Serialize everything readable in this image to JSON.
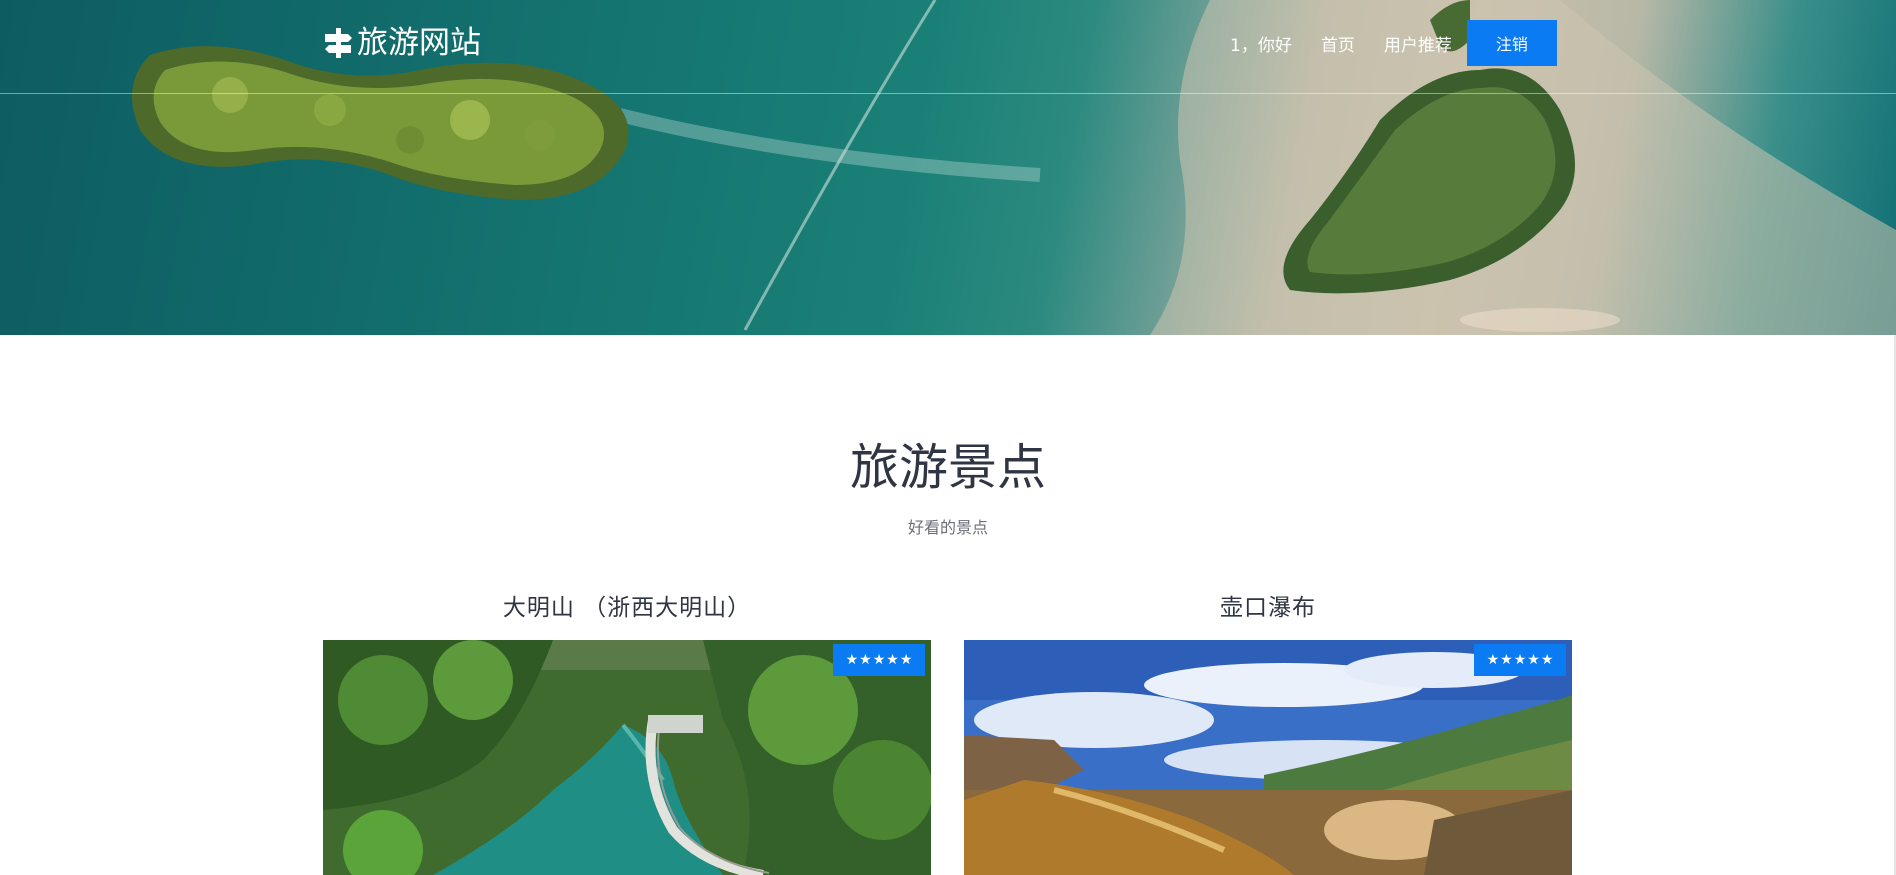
{
  "header": {
    "logo_text": "旅游网站",
    "logo_icon": "signpost-icon",
    "nav": {
      "greeting": "1，你好",
      "home": "首页",
      "recommend": "用户推荐",
      "logout": "注销"
    }
  },
  "section": {
    "title": "旅游景点",
    "subtitle": "好看的景点"
  },
  "attractions": [
    {
      "name": "大明山 （浙西大明山）",
      "rating": 5,
      "rating_max": 5
    },
    {
      "name": "壶口瀑布",
      "rating": 5,
      "rating_max": 5
    }
  ],
  "colors": {
    "accent": "#0a7bf2",
    "text_dark": "#2f3542",
    "text_muted": "#6b6f78"
  }
}
